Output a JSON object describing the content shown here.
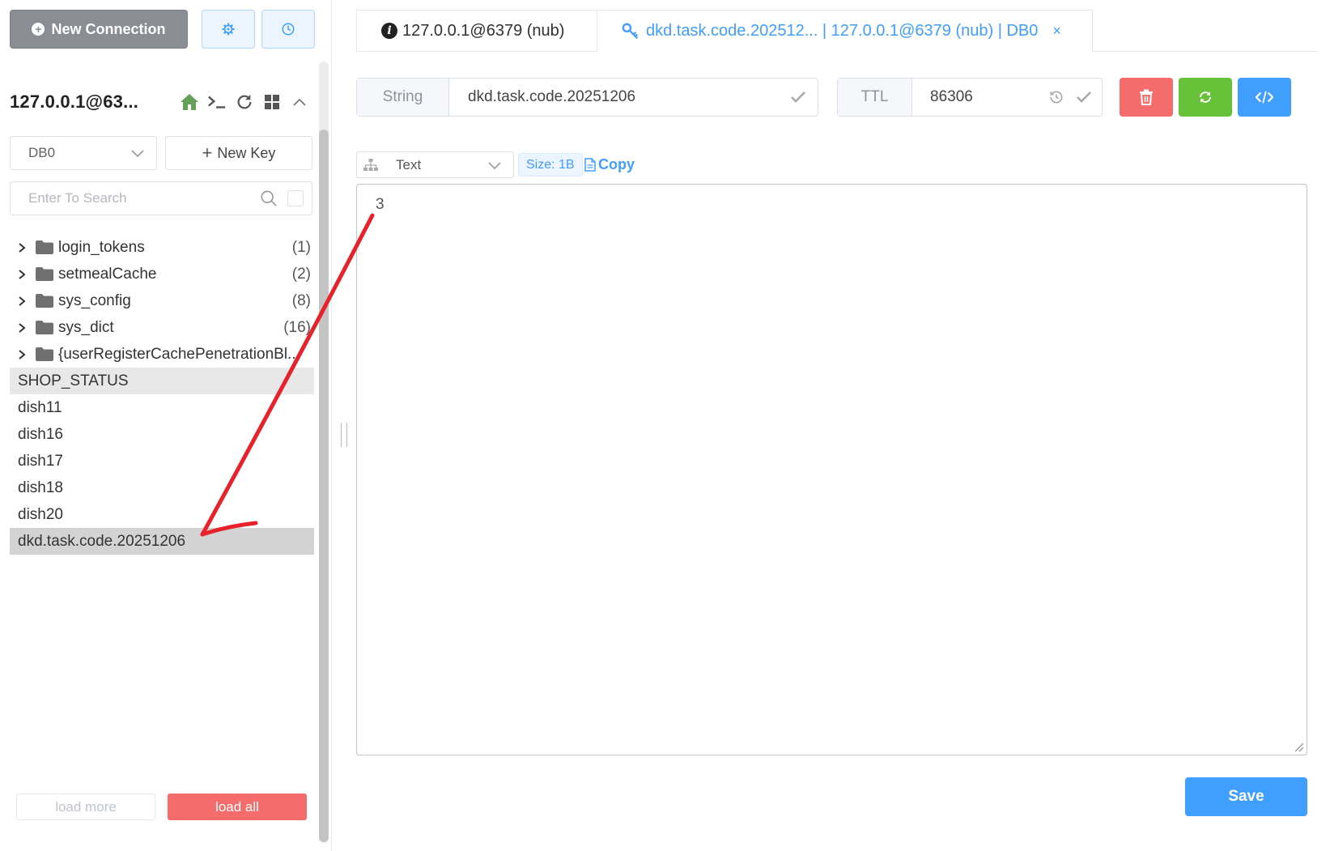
{
  "sidebar": {
    "new_connection_label": "New Connection",
    "connection_name": "127.0.0.1@63...",
    "db_select_value": "DB0",
    "new_key_label": "New Key",
    "search_placeholder": "Enter To Search",
    "folders": [
      {
        "name": "login_tokens",
        "count": "(1)"
      },
      {
        "name": "setmealCache",
        "count": "(2)"
      },
      {
        "name": "sys_config",
        "count": "(8)"
      },
      {
        "name": "sys_dict",
        "count": "(16)"
      },
      {
        "name": "{userRegisterCachePenetrationBl...",
        "count": ""
      }
    ],
    "keys": [
      "SHOP_STATUS",
      "dish11",
      "dish16",
      "dish17",
      "dish18",
      "dish20",
      "dkd.task.code.20251206"
    ],
    "load_more_label": "load more",
    "load_all_label": "load all"
  },
  "tabs": [
    {
      "label": "127.0.0.1@6379 (nub)",
      "icon": "info-icon"
    },
    {
      "label": "dkd.task.code.202512... | 127.0.0.1@6379 (nub) | DB0",
      "icon": "key-icon"
    }
  ],
  "key_header": {
    "type": "String",
    "key_name": "dkd.task.code.20251206",
    "ttl_label": "TTL",
    "ttl_value": "86306"
  },
  "format_bar": {
    "format_value": "Text",
    "size": "Size: 1B",
    "copy_label": "Copy"
  },
  "value": "3",
  "save_label": "Save",
  "colors": {
    "primary": "#409eff",
    "danger": "#f56c6c",
    "success": "#67c23a",
    "annotation": "#e8222a"
  }
}
